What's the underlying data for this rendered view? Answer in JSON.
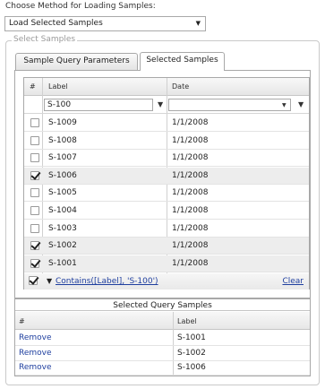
{
  "method": {
    "label": "Choose Method for Loading Samples:",
    "selected": "Load Selected Samples"
  },
  "fieldset_legend": "Select Samples",
  "tabs": [
    {
      "label": "Sample Query Parameters",
      "active": false
    },
    {
      "label": "Selected Samples",
      "active": true
    }
  ],
  "grid": {
    "columns": [
      "#",
      "Label",
      "Date"
    ],
    "filter": {
      "label_value": "S-100",
      "date_value": ""
    },
    "rows": [
      {
        "label": "S-1009",
        "date": "1/1/2008",
        "checked": false
      },
      {
        "label": "S-1008",
        "date": "1/1/2008",
        "checked": false
      },
      {
        "label": "S-1007",
        "date": "1/1/2008",
        "checked": false
      },
      {
        "label": "S-1006",
        "date": "1/1/2008",
        "checked": true
      },
      {
        "label": "S-1005",
        "date": "1/1/2008",
        "checked": false
      },
      {
        "label": "S-1004",
        "date": "1/1/2008",
        "checked": false
      },
      {
        "label": "S-1003",
        "date": "1/1/2008",
        "checked": false
      },
      {
        "label": "S-1002",
        "date": "1/1/2008",
        "checked": true
      },
      {
        "label": "S-1001",
        "date": "1/1/2008",
        "checked": true
      }
    ],
    "footer": {
      "filter_expression": "Contains([Label], 'S-100')",
      "clear_label": "Clear"
    }
  },
  "selected_query_samples": {
    "title": "Selected Query Samples",
    "columns": [
      "#",
      "Label"
    ],
    "rows": [
      {
        "action": "Remove",
        "label": "S-1001"
      },
      {
        "action": "Remove",
        "label": "S-1002"
      },
      {
        "action": "Remove",
        "label": "S-1006"
      }
    ]
  },
  "icons": {
    "dropdown": "chevron-down-icon",
    "filter": "funnel-icon",
    "checkbox": "checkbox-icon"
  }
}
